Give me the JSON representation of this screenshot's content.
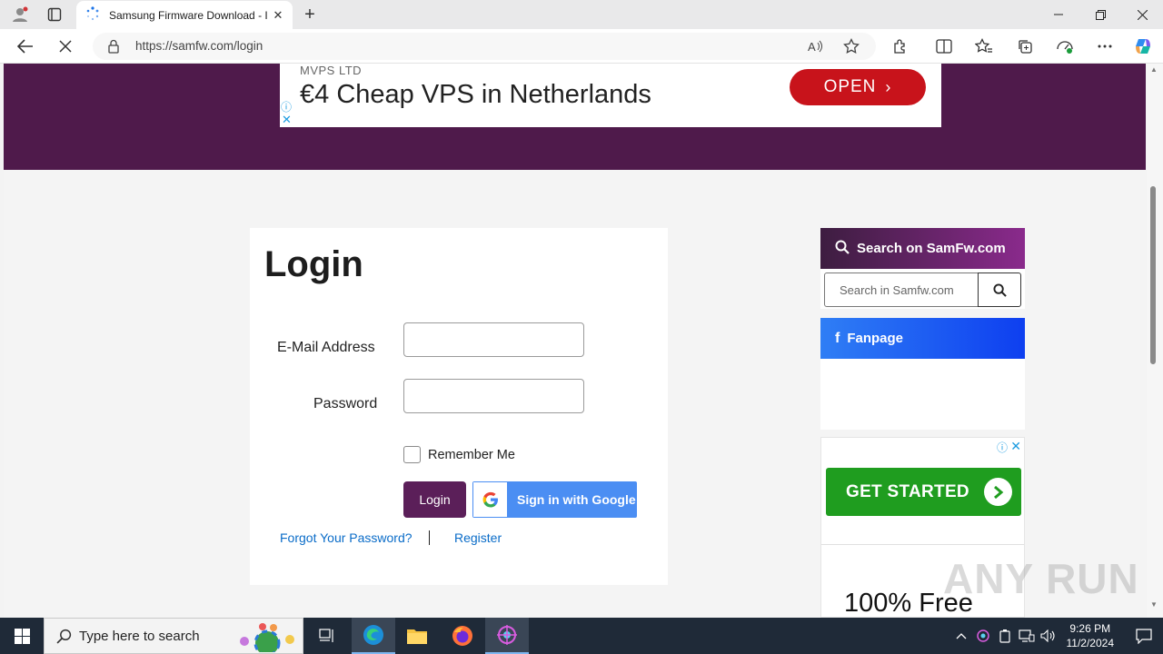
{
  "browser": {
    "tab_title": "Samsung Firmware Download - I",
    "url": "https://samfw.com/login"
  },
  "top_ad": {
    "company": "MVPS LTD",
    "headline": "€4 Cheap VPS in Netherlands",
    "cta": "OPEN"
  },
  "login": {
    "title": "Login",
    "email_label": "E-Mail Address",
    "email_value": "",
    "password_label": "Password",
    "password_value": "",
    "remember_label": "Remember Me",
    "login_button": "Login",
    "google_button": "Sign in with Google",
    "forgot_link": "Forgot Your Password?",
    "register_link": "Register"
  },
  "sidebar": {
    "search_header": "Search on SamFw.com",
    "search_placeholder": "Search in Samfw.com",
    "fanpage_header": "Fanpage",
    "ad_cta": "GET STARTED",
    "ad_text": "100% Free"
  },
  "watermark": "ANY RUN",
  "taskbar": {
    "search_placeholder": "Type here to search",
    "time": "9:26 PM",
    "date": "11/2/2024"
  }
}
